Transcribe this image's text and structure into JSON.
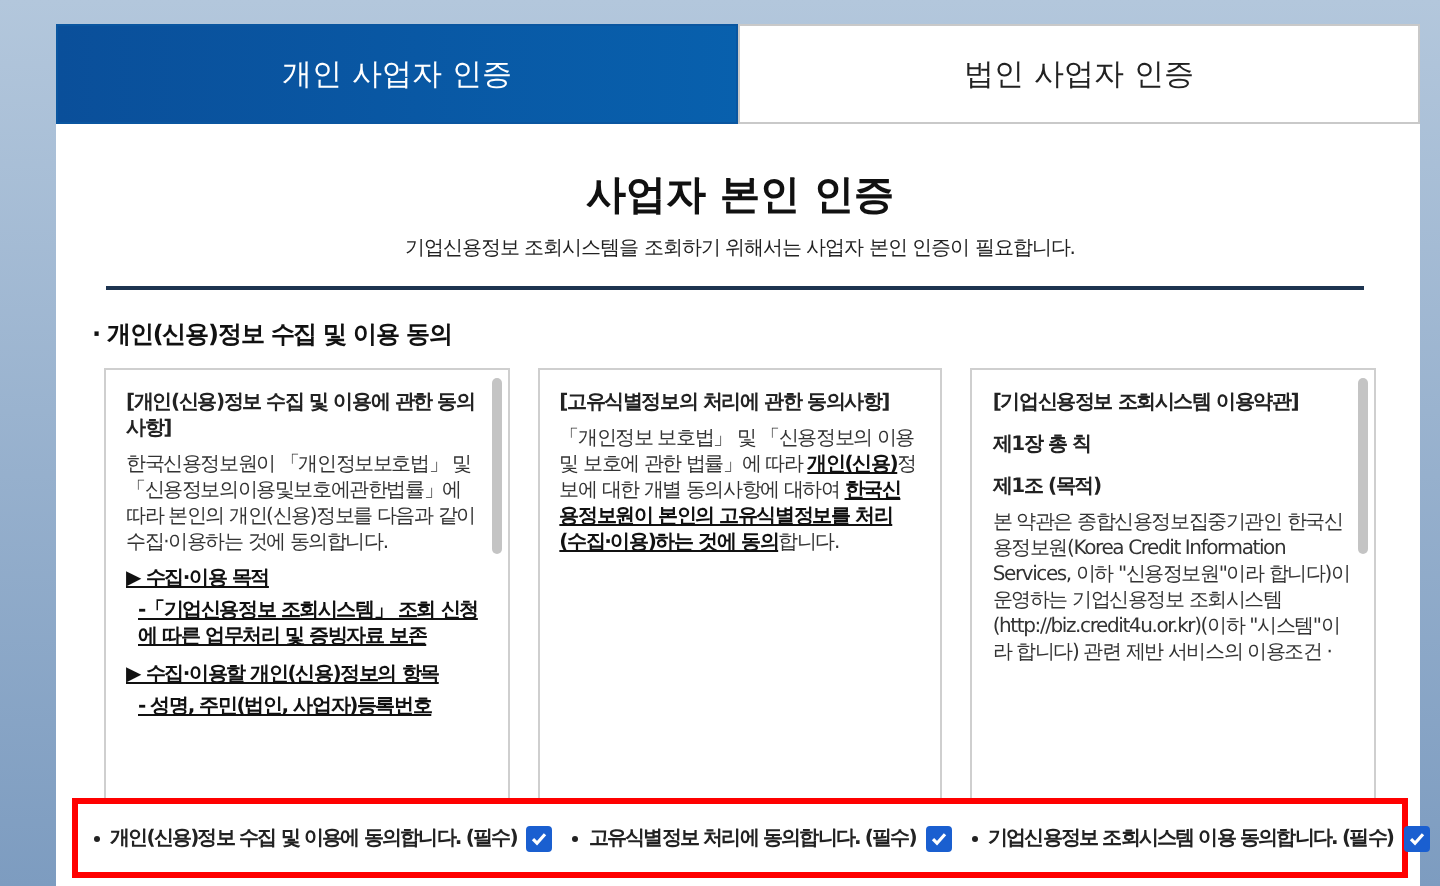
{
  "tabs": [
    {
      "label": "개인 사업자 인증",
      "selected": true
    },
    {
      "label": "법인 사업자 인증",
      "selected": false
    }
  ],
  "title": "사업자 본인 인증",
  "subtitle": "기업신용정보 조회시스템을 조회하기 위해서는 사업자 본인 인증이 필요합니다.",
  "section_heading": "· 개인(신용)정보 수집 및 이용 동의",
  "cards": [
    {
      "scrollbar": true,
      "blocks": [
        {
          "kind": "heading",
          "text": "[개인(신용)정보 수집 및 이용에 관한 동의사항]"
        },
        {
          "kind": "paragraph",
          "text": "한국신용정보원이 「개인정보보호법」 및 「신용정보의이용및보호에관한법률」에 따라 본인의 개인(신용)정보를 다음과 같이 수집·이용하는 것에 동의합니다."
        },
        {
          "kind": "item",
          "text": "▶ 수집·이용 목적"
        },
        {
          "kind": "subitem",
          "text": "-「기업신용정보 조회시스템」 조회 신청에 따른 업무처리 및 증빙자료 보존"
        },
        {
          "kind": "item",
          "text": "▶ 수집·이용할 개인(신용)정보의 항목"
        },
        {
          "kind": "subitem",
          "text": "- 성명, 주민(법인, 사업자)등록번호"
        }
      ]
    },
    {
      "scrollbar": false,
      "blocks": [
        {
          "kind": "heading",
          "text": "[고유식별정보의 처리에 관한 동의사항]"
        },
        {
          "kind": "paragraph",
          "text": "「개인정보 보호법」 및 「신용정보의 이용 및 보호에 관한 법률」에 따라 **개인(신용)**정보에 대한 개별 동의사항에 대하여 **한국신용정보원이 본인의 고유식별정보를 처리(수집·이용)하는 것에 동의**합니다."
        }
      ]
    },
    {
      "scrollbar": true,
      "blocks": [
        {
          "kind": "heading",
          "text": "[기업신용정보 조회시스템 이용약관]"
        },
        {
          "kind": "chapter",
          "text": "제1장 총 칙"
        },
        {
          "kind": "chapter",
          "text": "제1조 (목적)"
        },
        {
          "kind": "paragraph",
          "text": "본 약관은 종합신용정보집중기관인 한국신용정보원(Korea Credit Information Services, 이하 \"신용정보원\"이라 합니다)이 운영하는 기업신용정보 조회시스템(http://biz.credit4u.or.kr)(이하 \"시스템\"이라 합니다) 관련 제반 서비스의 이용조건 ·"
        }
      ]
    }
  ],
  "agreements": [
    {
      "label": "개인(신용)정보 수집 및 이용에 동의합니다. (필수)",
      "checked": true
    },
    {
      "label": "고유식별정보 처리에 동의합니다. (필수)",
      "checked": true
    },
    {
      "label": "기업신용정보 조회시스템 이용 동의합니다. (필수)",
      "checked": true
    }
  ]
}
